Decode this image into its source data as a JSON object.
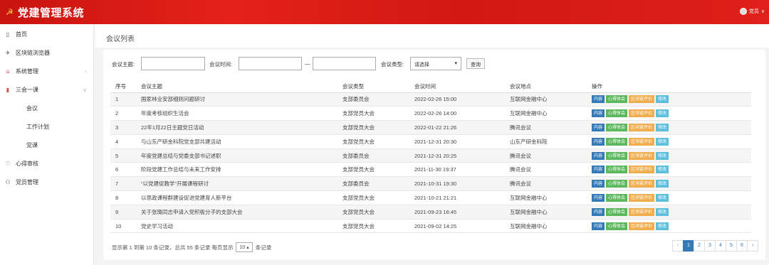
{
  "app": {
    "title": "党建管理系统",
    "emblem": "☭"
  },
  "user": {
    "name": "党员",
    "caret": "∨"
  },
  "sidebar": {
    "items": [
      {
        "icon": "▯",
        "label": "首页"
      },
      {
        "icon": "✈",
        "label": "区块链浏览器"
      },
      {
        "icon": "⌂",
        "label": "系统管理",
        "arrow": "‹"
      },
      {
        "icon": "▮",
        "label": "三会一课",
        "arrow": "∨"
      },
      {
        "icon": "♡",
        "label": "心得审核"
      },
      {
        "icon": "⚇",
        "label": "党员管理"
      }
    ],
    "sub": [
      "会议",
      "工作计划",
      "党课"
    ]
  },
  "page": {
    "title": "会议列表"
  },
  "filter": {
    "topic_label": "会议主题:",
    "time_label": "会议时间:",
    "dash": "—",
    "type_label": "会议类型:",
    "type_value": "请选择",
    "type_caret": "▾",
    "query_button": "查询"
  },
  "table": {
    "headers": [
      "序号",
      "会议主题",
      "会议类型",
      "会议时间",
      "会议地点",
      "操作"
    ],
    "actions": [
      "内容",
      "心得体会",
      "区块链评价",
      "修改"
    ],
    "rows": [
      [
        "1",
        "国家林业安部细则问题研讨",
        "支部委员会",
        "2022-02-26 15:00",
        "互联网金融中心"
      ],
      [
        "2",
        "年度考核组织生活会",
        "支部党员大会",
        "2022-02-26 14:00",
        "互联网金融中心"
      ],
      [
        "3",
        "22年1月22日主题党日活动",
        "支部党员大会",
        "2022-01-22 21:26",
        "腾讯会议"
      ],
      [
        "4",
        "与山东产研金科院党支部共建活动",
        "支部党员大会",
        "2021-12-31 20:30",
        "山东产研金科院"
      ],
      [
        "5",
        "年度党建总结与党委支部书记述职",
        "支部委员会",
        "2021-12-31 20:25",
        "腾讯会议"
      ],
      [
        "6",
        "阶段党建工作总结与未来工作安排",
        "支部党员大会",
        "2021-11-30 19:37",
        "腾讯会议"
      ],
      [
        "7",
        "“以党建促教学”开展课程研讨",
        "支部委员会",
        "2021-10-31 19:30",
        "腾讯会议"
      ],
      [
        "8",
        "以思政课程群建设促进党建育人新平台",
        "支部党员大会",
        "2021-10-21 21:21",
        "互联网金融中心"
      ],
      [
        "9",
        "关于张璐同志申请入党积极分子的支部大会",
        "支部党员大会",
        "2021-09-23 16:45",
        "互联网金融中心"
      ],
      [
        "10",
        "党史学习活动",
        "支部党员大会",
        "2021-09-02 14:25",
        "互联网金融中心"
      ]
    ]
  },
  "pagination": {
    "info_prefix": "显示第 1 到第 10 条记录，总共 55 条记录 每页显示",
    "page_size": "10 ▴",
    "info_suffix": "条记录",
    "prev": "‹",
    "pages": [
      "1",
      "2",
      "3",
      "4",
      "5",
      "6"
    ],
    "next": "›",
    "current": "1"
  }
}
